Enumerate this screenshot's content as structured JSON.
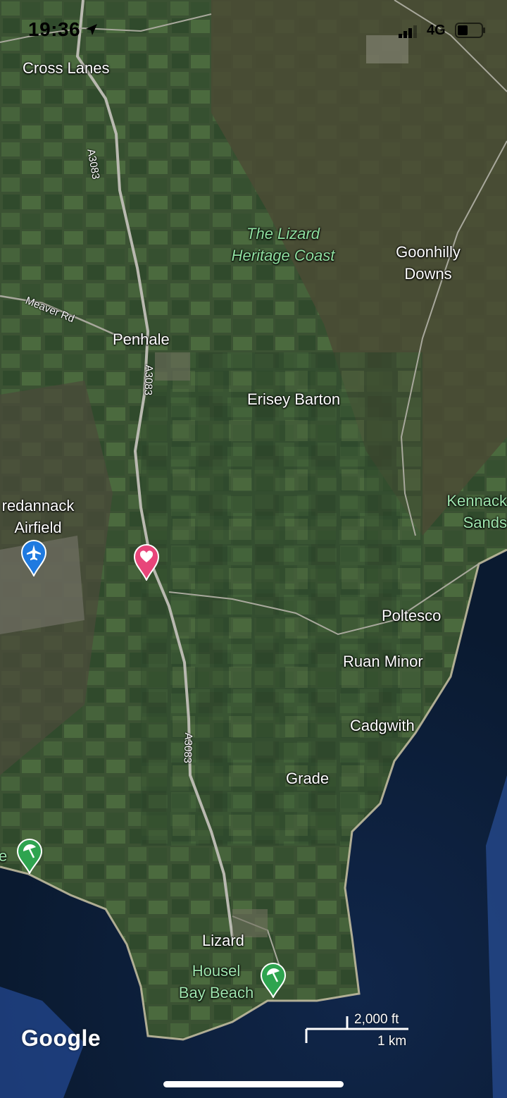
{
  "status_bar": {
    "time": "19:36",
    "network": "4G",
    "location_icon": "location-arrow-icon",
    "signal_icon": "cellular-signal-icon",
    "battery_icon": "battery-icon"
  },
  "map": {
    "provider": "Google",
    "style": "satellite",
    "places": {
      "cross_lanes": "Cross Lanes",
      "lizard_heritage_line1": "The Lizard",
      "lizard_heritage_line2": "Heritage Coast",
      "goonhilly_line1": "Goonhilly",
      "goonhilly_line2": "Downs",
      "penhale": "Penhale",
      "erisey_barton": "Erisey Barton",
      "predannack_line1": "redannack",
      "predannack_line2": "Airfield",
      "kennack_line1": "Kennack",
      "kennack_line2": "Sands",
      "poltesco": "Poltesco",
      "ruan_minor": "Ruan Minor",
      "cadgwith": "Cadgwith",
      "grade": "Grade",
      "lizard": "Lizard",
      "housel_line1": "Housel",
      "housel_line2": "Bay Beach",
      "cut_label_left": "e"
    },
    "roads": {
      "a3083": "A3083",
      "meaver_rd": "Meaver Rd"
    },
    "pins": [
      {
        "name": "saved-place",
        "icon": "heart-icon",
        "color": "#e8457a"
      },
      {
        "name": "airport",
        "icon": "airplane-icon",
        "color": "#1f7ae0"
      },
      {
        "name": "beach-left",
        "icon": "beach-umbrella-icon",
        "color": "#2ea44f"
      },
      {
        "name": "housel-bay-beach",
        "icon": "beach-umbrella-icon",
        "color": "#2ea44f"
      }
    ],
    "scale": {
      "imperial": "2,000 ft",
      "metric": "1 km"
    }
  }
}
